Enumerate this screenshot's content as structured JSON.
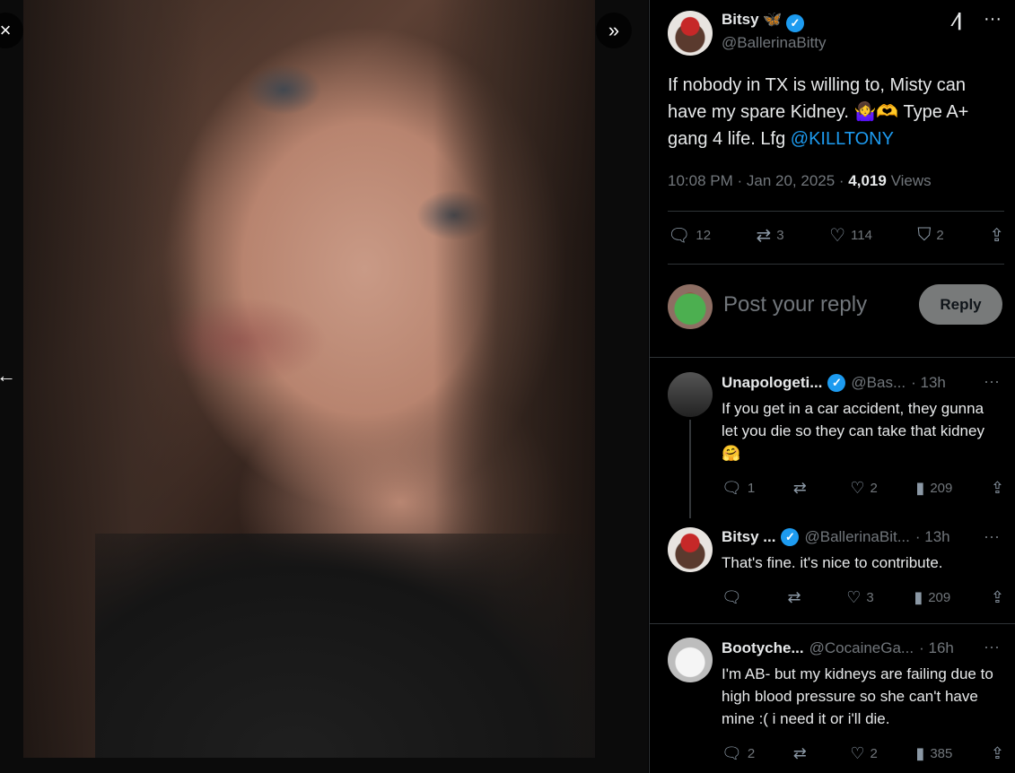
{
  "media": {
    "close_icon": "×",
    "expand_icon": "»",
    "back_icon": "←"
  },
  "tweet": {
    "author_name": "Bitsy 🦋",
    "author_handle": "@BallerinaBitty",
    "text": "If nobody in TX is willing to, Misty can have my spare Kidney. 🤷‍♀️🫶 Type A+ gang 4 life. Lfg ",
    "mention": "@KILLTONY",
    "time": "10:08 PM · Jan 20, 2025 · ",
    "views_count": "4,019",
    "views_label": " Views",
    "replies": "12",
    "reposts": "3",
    "likes": "114",
    "bookmarks": "2"
  },
  "compose": {
    "placeholder": "Post your reply",
    "reply_button": "Reply"
  },
  "replies": [
    {
      "name": "Unapologeti...",
      "handle": "@Bas...",
      "time": "· 13h",
      "text": "If you get in a car accident, they gunna let you die so they can take that kidney 🤗",
      "replies": "1",
      "reposts": "",
      "likes": "2",
      "views": "209"
    },
    {
      "name": "Bitsy ...",
      "handle": "@BallerinaBit...",
      "time": "· 13h",
      "text": "That's fine. it's nice to contribute.",
      "replies": "",
      "reposts": "",
      "likes": "3",
      "views": "209"
    },
    {
      "name": "Bootyche...",
      "handle": "@CocaineGa...",
      "time": "· 16h",
      "text": "I'm AB- but my kidneys are failing due to high blood pressure so she can't have mine :( i need it or i'll die.",
      "replies": "2",
      "reposts": "",
      "likes": "2",
      "views": "385"
    }
  ]
}
